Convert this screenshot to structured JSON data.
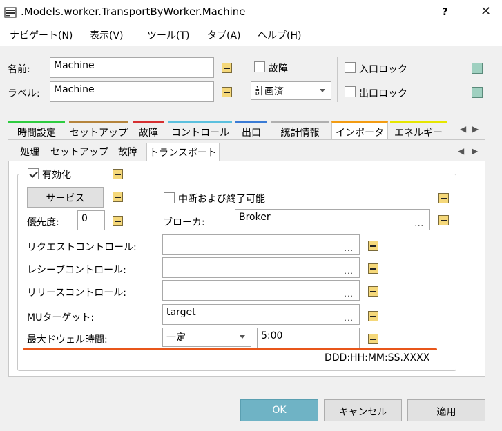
{
  "window": {
    "title": ".Models.worker.TransportByWorker.Machine",
    "help": "?",
    "close": "✕"
  },
  "menu": [
    "ナビゲート(N)",
    "表示(V)",
    "ツール(T)",
    "タブ(A)",
    "ヘルプ(H)"
  ],
  "header": {
    "name_label": "名前:",
    "name_value": "Machine",
    "label_label": "ラベル:",
    "label_value": "Machine",
    "failure_label": "故障",
    "failure_checked": false,
    "failure_mode": "計画済",
    "entry_lock_label": "入口ロック",
    "entry_lock_checked": false,
    "exit_lock_label": "出口ロック",
    "exit_lock_checked": false
  },
  "tabs": [
    {
      "label": "時間設定",
      "color": "#2ecc40"
    },
    {
      "label": "セットアップ",
      "color": "#b5843c"
    },
    {
      "label": "故障",
      "color": "#d63031"
    },
    {
      "label": "コントロール",
      "color": "#5bc0de"
    },
    {
      "label": "出口",
      "color": "#3a7bd5"
    },
    {
      "label": "統計情報",
      "color": "#b0b0b0"
    },
    {
      "label": "インポータ",
      "color": "#f39c12"
    },
    {
      "label": "エネルギー",
      "color": "#e6e600"
    }
  ],
  "active_tab": "インポータ",
  "subtabs": [
    "処理",
    "セットアップ",
    "故障",
    "トランスポート"
  ],
  "active_subtab": "トランスポート",
  "transport": {
    "enabled_label": "有効化",
    "enabled_checked": true,
    "service_button": "サービス",
    "interrupt_label": "中断および終了可能",
    "interrupt_checked": false,
    "priority_label": "優先度:",
    "priority_value": "0",
    "broker_label": "ブローカ:",
    "broker_value": "Broker",
    "request_control_label": "リクエストコントロール:",
    "request_control_value": "",
    "receive_control_label": "レシーブコントロール:",
    "receive_control_value": "",
    "release_control_label": "リリースコントロール:",
    "release_control_value": "",
    "mu_target_label": "MUターゲット:",
    "mu_target_value": "target",
    "max_dwell_label": "最大ドウェル時間:",
    "max_dwell_mode": "一定",
    "max_dwell_value": "5:00",
    "time_format": "DDD:HH:MM:SS.XXXX",
    "dots": "..."
  },
  "buttons": {
    "ok": "OK",
    "cancel": "キャンセル",
    "apply": "適用"
  },
  "colors": {
    "accent_mark": "#e8561a",
    "ok_button": "#6fb3c5"
  }
}
